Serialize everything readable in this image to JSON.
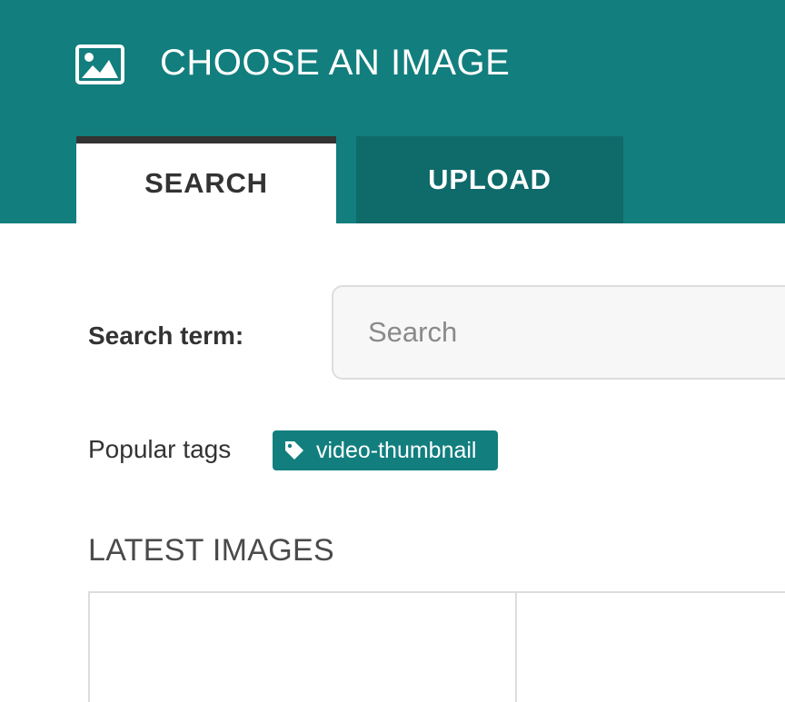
{
  "header": {
    "title": "CHOOSE AN IMAGE",
    "icon": "image-icon",
    "background_color": "#127e7e"
  },
  "tabs": [
    {
      "label": "SEARCH",
      "active": true
    },
    {
      "label": "UPLOAD",
      "active": false
    }
  ],
  "search": {
    "label": "Search term:",
    "placeholder": "Search",
    "value": ""
  },
  "popular_tags": {
    "label": "Popular tags",
    "tags": [
      {
        "label": "video-thumbnail",
        "icon": "tag-icon"
      }
    ]
  },
  "latest_images": {
    "title": "LATEST IMAGES"
  },
  "colors": {
    "accent": "#127e7e",
    "accent_dark": "#0f6a6a",
    "text": "#333333"
  }
}
